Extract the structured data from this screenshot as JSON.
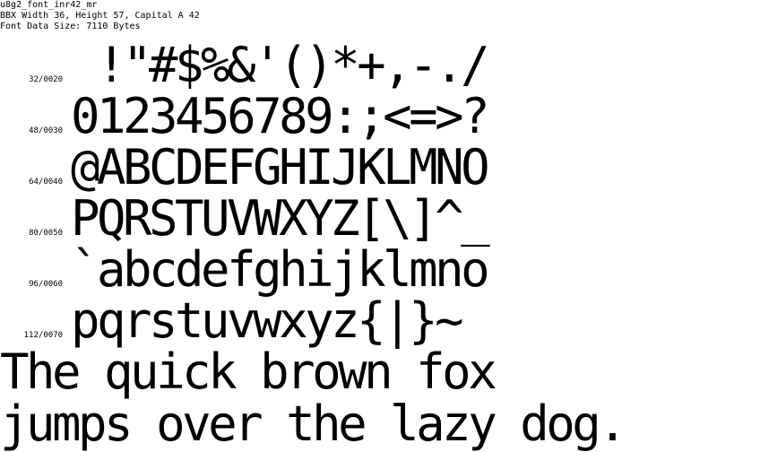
{
  "header": {
    "font_name": "u8g2_font_inr42_mr",
    "bbx_info": "BBX Width 36, Height 57, Capital A 42",
    "data_size": "Font Data Size: 7110 Bytes"
  },
  "rows": [
    {
      "code": "32/0020",
      "glyphs": " !\"#$%&'()*+,-./"
    },
    {
      "code": "48/0030",
      "glyphs": "0123456789:;<=>?"
    },
    {
      "code": "64/0040",
      "glyphs": "@ABCDEFGHIJKLMNO"
    },
    {
      "code": "80/0050",
      "glyphs": "PQRSTUVWXYZ[\\]^_"
    },
    {
      "code": "96/0060",
      "glyphs": "`abcdefghijklmno"
    },
    {
      "code": "112/0070",
      "glyphs": "pqrstuvwxyz{|}~"
    }
  ],
  "sample": {
    "line1": "The quick brown fox",
    "line2": "jumps over the lazy dog."
  }
}
